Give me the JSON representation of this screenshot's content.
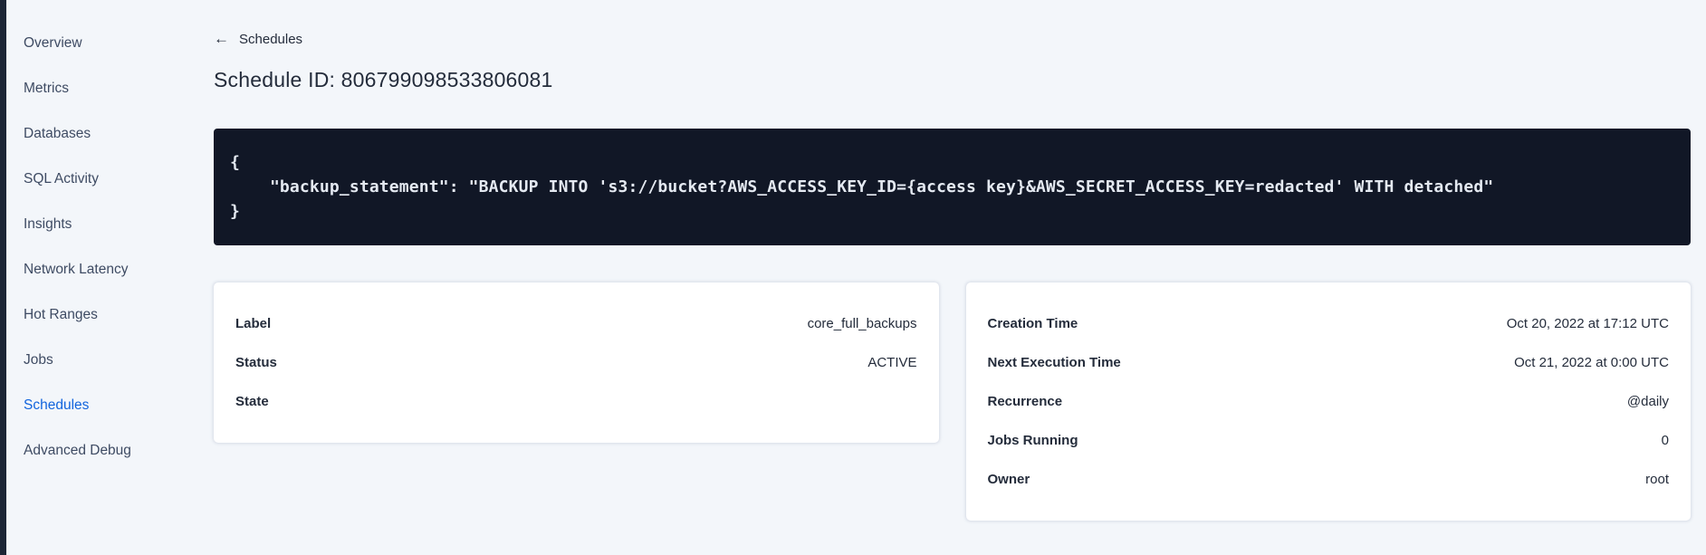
{
  "sidebar": {
    "items": [
      {
        "label": "Overview",
        "active": false
      },
      {
        "label": "Metrics",
        "active": false
      },
      {
        "label": "Databases",
        "active": false
      },
      {
        "label": "SQL Activity",
        "active": false
      },
      {
        "label": "Insights",
        "active": false
      },
      {
        "label": "Network Latency",
        "active": false
      },
      {
        "label": "Hot Ranges",
        "active": false
      },
      {
        "label": "Jobs",
        "active": false
      },
      {
        "label": "Schedules",
        "active": true
      },
      {
        "label": "Advanced Debug",
        "active": false
      }
    ]
  },
  "header": {
    "back_icon": "←",
    "back_label": "Schedules",
    "title": "Schedule ID: 806799098533806081"
  },
  "code_block": {
    "lines": [
      "{",
      "    \"backup_statement\": \"BACKUP INTO 's3://bucket?AWS_ACCESS_KEY_ID={access key}&AWS_SECRET_ACCESS_KEY=redacted' WITH detached\"",
      "}"
    ]
  },
  "label_card": {
    "rows": [
      {
        "label": "Label",
        "value": "core_full_backups"
      },
      {
        "label": "Status",
        "value": "ACTIVE"
      },
      {
        "label": "State",
        "value": ""
      }
    ]
  },
  "schedule_card": {
    "rows": [
      {
        "label": "Creation Time",
        "value": "Oct 20, 2022 at 17:12 UTC"
      },
      {
        "label": "Next Execution Time",
        "value": "Oct 21, 2022 at 0:00 UTC"
      },
      {
        "label": "Recurrence",
        "value": "@daily"
      },
      {
        "label": "Jobs Running",
        "value": "0"
      },
      {
        "label": "Owner",
        "value": "root"
      }
    ]
  },
  "colors": {
    "accent_blue": "#1164dd",
    "code_background": "#111726",
    "page_background": "#f3f6fa",
    "text_dark": "#242c3b"
  }
}
